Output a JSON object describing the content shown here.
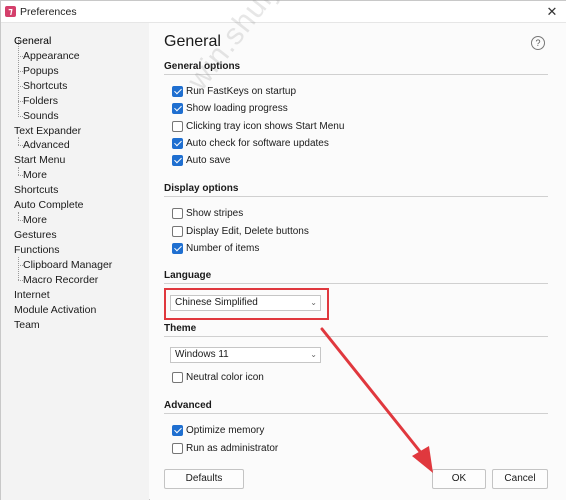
{
  "window": {
    "title": "Preferences",
    "close_glyph": "✕",
    "app_icon_glyph": "⁊"
  },
  "sidebar": {
    "items": [
      {
        "label": "General",
        "level": 0,
        "selected": true
      },
      {
        "label": "Appearance",
        "level": 1
      },
      {
        "label": "Popups",
        "level": 1
      },
      {
        "label": "Shortcuts",
        "level": 1
      },
      {
        "label": "Folders",
        "level": 1
      },
      {
        "label": "Sounds",
        "level": 1
      },
      {
        "label": "Text Expander",
        "level": 0
      },
      {
        "label": "Advanced",
        "level": 1
      },
      {
        "label": "Start Menu",
        "level": 0
      },
      {
        "label": "More",
        "level": 1
      },
      {
        "label": "Shortcuts",
        "level": 0
      },
      {
        "label": "Auto Complete",
        "level": 0
      },
      {
        "label": "More",
        "level": 1
      },
      {
        "label": "Gestures",
        "level": 0
      },
      {
        "label": "Functions",
        "level": 0
      },
      {
        "label": "Clipboard Manager",
        "level": 1
      },
      {
        "label": "Macro Recorder",
        "level": 1
      },
      {
        "label": "Internet",
        "level": 0
      },
      {
        "label": "Module Activation",
        "level": 0
      },
      {
        "label": "Team",
        "level": 0
      }
    ]
  },
  "main": {
    "title": "General",
    "help_glyph": "?",
    "sections": {
      "general_options": {
        "title": "General options",
        "options": [
          {
            "label": "Run FastKeys on startup",
            "checked": true
          },
          {
            "label": "Show loading progress",
            "checked": true
          },
          {
            "label": "Clicking tray icon shows Start Menu",
            "checked": false
          },
          {
            "label": "Auto check for software updates",
            "checked": true
          },
          {
            "label": "Auto save",
            "checked": true
          }
        ]
      },
      "display_options": {
        "title": "Display options",
        "options": [
          {
            "label": "Show stripes",
            "checked": false
          },
          {
            "label": "Display Edit, Delete buttons",
            "checked": false
          },
          {
            "label": "Number of items",
            "checked": true
          }
        ]
      },
      "language": {
        "title": "Language",
        "selected": "Chinese Simplified",
        "highlight_color": "#e0383e"
      },
      "theme": {
        "title": "Theme",
        "selected": "Windows 11",
        "options": [
          {
            "label": "Neutral color icon",
            "checked": false
          }
        ]
      },
      "advanced": {
        "title": "Advanced",
        "options": [
          {
            "label": "Optimize memory",
            "checked": true
          },
          {
            "label": "Run as administrator",
            "checked": false
          }
        ]
      }
    }
  },
  "footer": {
    "defaults_label": "Defaults",
    "ok_label": "OK",
    "cancel_label": "Cancel"
  },
  "watermark": "win.shuijiao.cc",
  "colors": {
    "accent": "#1f6fd0",
    "annotation": "#e0383e"
  },
  "icons": {
    "chevron": "chevron-down-icon",
    "check": "checkmark-icon",
    "help": "help-circle-icon",
    "close": "close-icon"
  }
}
